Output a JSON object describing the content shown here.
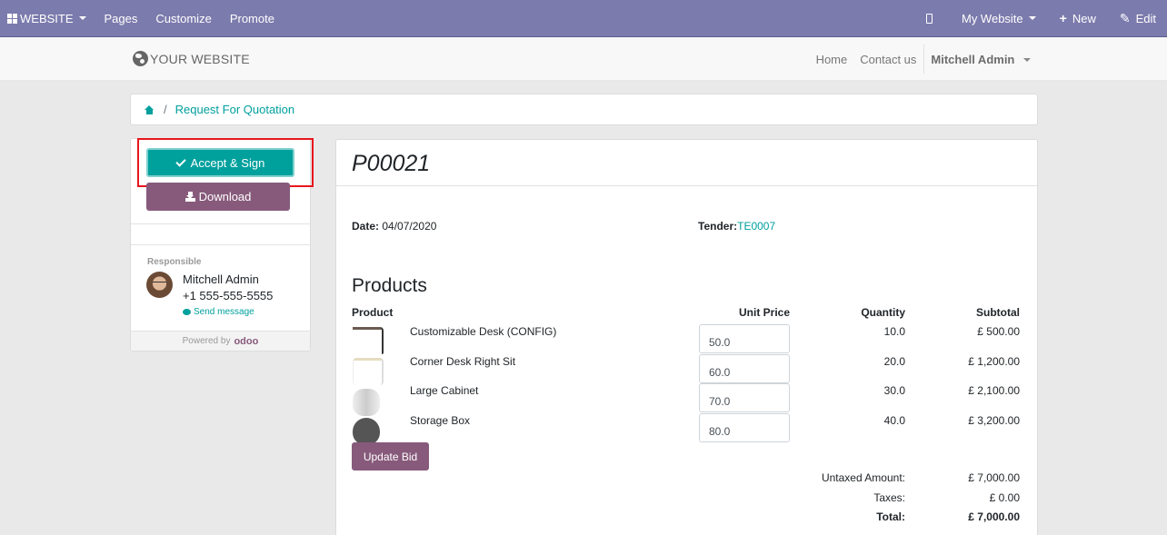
{
  "topbar": {
    "app_label": "WEBSITE",
    "menu": [
      "Pages",
      "Customize",
      "Promote"
    ],
    "website_selector": "My Website",
    "new_label": "New",
    "edit_label": "Edit"
  },
  "site_header": {
    "logo_text": "YOUR WEBSITE",
    "nav": [
      "Home",
      "Contact us"
    ],
    "user_name": "Mitchell Admin"
  },
  "breadcrumb": {
    "separator": "/",
    "current": "Request For Quotation"
  },
  "sidebar": {
    "accept_label": "Accept & Sign",
    "download_label": "Download",
    "responsible_label": "Responsible",
    "responsible_name": "Mitchell Admin",
    "responsible_phone": "+1 555-555-5555",
    "send_message_label": "Send message",
    "powered_by": "Powered by",
    "powered_brand": "odoo"
  },
  "document": {
    "title": "P00021",
    "date_label": "Date:",
    "date_value": "04/07/2020",
    "tender_label": "Tender:",
    "tender_value": "TE0007",
    "products_heading": "Products",
    "columns": {
      "product": "Product",
      "unit_price": "Unit Price",
      "quantity": "Quantity",
      "subtotal": "Subtotal"
    },
    "lines": [
      {
        "name": "Customizable Desk (CONFIG)",
        "unit_price": "50.0",
        "quantity": "10.0",
        "subtotal": "£ 500.00"
      },
      {
        "name": "Corner Desk Right Sit",
        "unit_price": "60.0",
        "quantity": "20.0",
        "subtotal": "£ 1,200.00"
      },
      {
        "name": "Large Cabinet",
        "unit_price": "70.0",
        "quantity": "30.0",
        "subtotal": "£ 2,100.00"
      },
      {
        "name": "Storage Box",
        "unit_price": "80.0",
        "quantity": "40.0",
        "subtotal": "£ 3,200.00"
      }
    ],
    "update_bid_label": "Update Bid",
    "totals": {
      "untaxed_label": "Untaxed Amount:",
      "untaxed_value": "£ 7,000.00",
      "taxes_label": "Taxes:",
      "taxes_value": "£ 0.00",
      "total_label": "Total:",
      "total_value": "£ 7,000.00"
    }
  },
  "colors": {
    "topbar": "#7c7bad",
    "primary": "#00a09d",
    "secondary": "#875a7b",
    "highlight_box": "#e8161d"
  }
}
